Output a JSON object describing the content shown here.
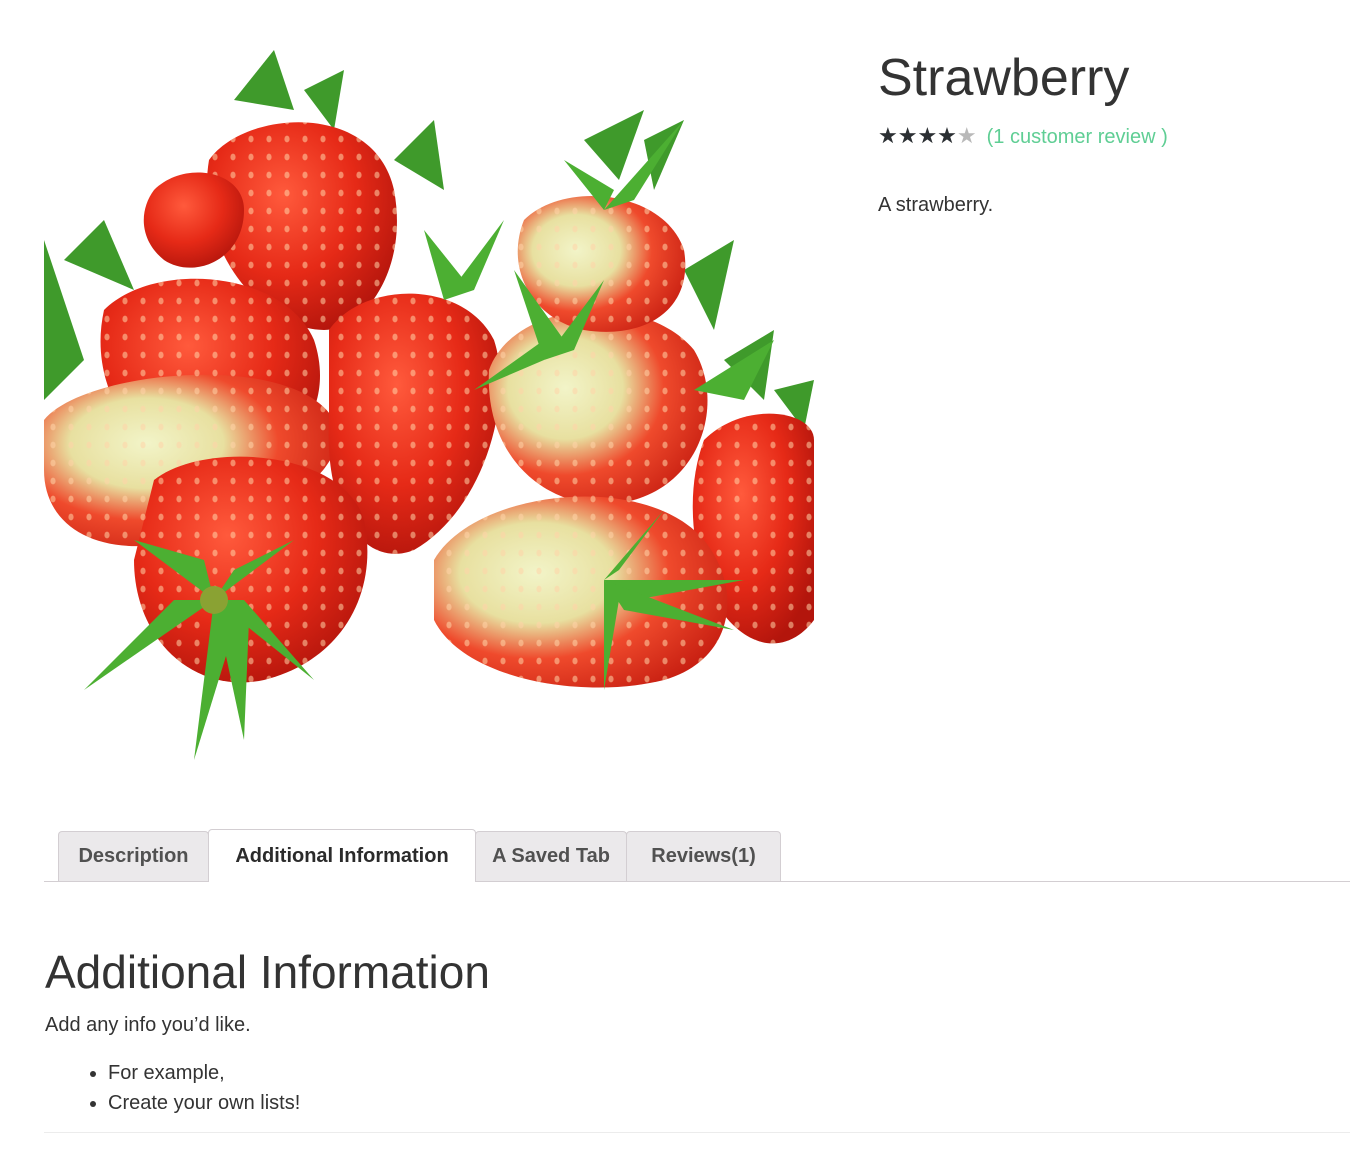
{
  "product": {
    "title": "Strawberry",
    "rating": {
      "value": 4,
      "max": 5,
      "stars_glyph": "★★★★★"
    },
    "review_link": "(1 customer review )",
    "short_description": "A strawberry.",
    "image_subject": "strawberries"
  },
  "tabs": [
    {
      "label": "Description",
      "active": false
    },
    {
      "label": "Additional Information",
      "active": true
    },
    {
      "label": "A Saved Tab",
      "active": false
    },
    {
      "label": "Reviews(1)",
      "active": false
    }
  ],
  "panel": {
    "heading": "Additional Information",
    "text": "Add any info you’d like.",
    "list": [
      "For example,",
      "Create your own lists!"
    ]
  },
  "colors": {
    "link_green": "#5fce94",
    "star_filled": "#2b2f33",
    "tab_inactive_bg": "#ebe9eb",
    "tab_border": "#d3ced2"
  }
}
